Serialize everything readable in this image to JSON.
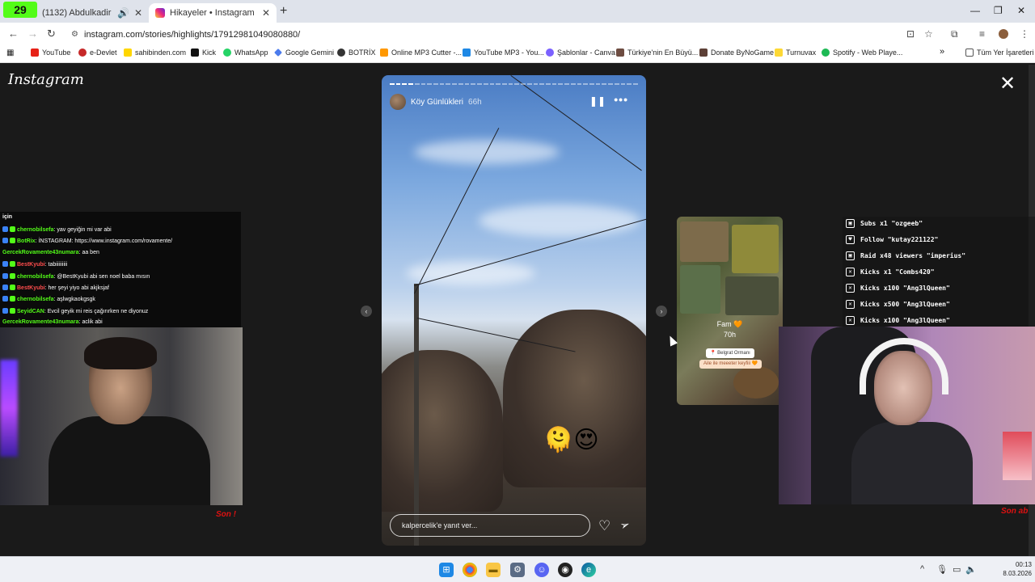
{
  "browser": {
    "kick_badge": "29",
    "tabs": [
      {
        "title": "(1132) Abdulkadir Geylani -",
        "close": "✕"
      },
      {
        "title": "Hikayeler • Instagram",
        "close": "✕"
      }
    ],
    "new_tab": "+",
    "url": "instagram.com/stories/highlights/17912981049080880/",
    "bookmarks": [
      {
        "label": "YouTube",
        "color": "#e62117"
      },
      {
        "label": "e-Devlet",
        "color": "#c62828"
      },
      {
        "label": "sahibinden.com",
        "color": "#ffd600"
      },
      {
        "label": "Kick",
        "color": "#111111"
      },
      {
        "label": "WhatsApp",
        "color": "#25d366"
      },
      {
        "label": "Google Gemini",
        "color": "#4b7bec"
      },
      {
        "label": "BOTRİX",
        "color": "#333333"
      },
      {
        "label": "Online MP3 Cutter -...",
        "color": "#ff9800"
      },
      {
        "label": "YouTube MP3 - You...",
        "color": "#1e88e5"
      },
      {
        "label": "Şablonlar - Canva",
        "color": "#7b61ff"
      },
      {
        "label": "Türkiye'nin En Büyü...",
        "color": "#6d4c41"
      },
      {
        "label": "Donate ByNoGame",
        "color": "#5d4037"
      },
      {
        "label": "Turnuvax",
        "color": "#fdd835"
      },
      {
        "label": "Spotify - Web Playe...",
        "color": "#1db954"
      }
    ],
    "bookmarks_more": "»",
    "all_bookmarks": "Tüm Yer İşaretleri"
  },
  "instagram": {
    "logo": "Instagram",
    "close": "✕",
    "story": {
      "username": "Köy Günlükleri",
      "time": "66h",
      "segments_total": 40,
      "segments_done": 4,
      "reply_placeholder": "kalpercelik'e yanıt ver...",
      "emojis": "🫠😍"
    },
    "next_story": {
      "title": "Fam 🧡",
      "time": "70h",
      "location": "📍 Belgrat Ormanı",
      "sub": "Aile ile meeeter keyfiii 🧡"
    }
  },
  "chat": {
    "header": "için",
    "messages": [
      {
        "user": "chernobilsefa",
        "text": ": yav geyiğin mi var abi",
        "color": "green",
        "badges": true
      },
      {
        "user": "BotRix",
        "text": ": İNSTAGRAM: https://www.instagram.com/rovamente/",
        "color": "green",
        "badges": true
      },
      {
        "user": "GercekRovamente43numara",
        "text": ": aa ben",
        "color": "green",
        "badges": false
      },
      {
        "user": "BestKyubi",
        "text": ": tabiiiiiiiii",
        "color": "red",
        "badges": true
      },
      {
        "user": "chernobilsefa",
        "text": ": @BestKyubi abi sen noel baba mısın",
        "color": "green",
        "badges": true
      },
      {
        "user": "BestKyubi",
        "text": ": her şeyi yiyo abi akjksjaf",
        "color": "red",
        "badges": true
      },
      {
        "user": "chernobilsefa",
        "text": ": aşlwgkaokgsgk",
        "color": "green",
        "badges": true
      },
      {
        "user": "SeyidCAN",
        "text": ": Evcil geyik mi reis çağırırken ne diyonuz",
        "color": "green",
        "badges": true
      },
      {
        "user": "GercekRovamente43numara",
        "text": ": aclik abi",
        "color": "green",
        "badges": false
      }
    ]
  },
  "overlay_labels": {
    "left": "Son !",
    "right": "Son ab"
  },
  "alerts": [
    {
      "icon": "box",
      "text": "Subs x1 \"ozgeeb\""
    },
    {
      "icon": "heart",
      "text": "Follow \"kutay221122\""
    },
    {
      "icon": "box",
      "text": "Raid x48 viewers \"imperius\""
    },
    {
      "icon": "x",
      "text": "Kicks x1 \"Combs420\""
    },
    {
      "icon": "x",
      "text": "Kicks x100 \"Ang3lQueen\""
    },
    {
      "icon": "x",
      "text": "Kicks x500 \"Ang3lQueen\""
    },
    {
      "icon": "x",
      "text": "Kicks x100 \"Ang3lQueen\""
    }
  ],
  "taskbar": {
    "time": "00:13",
    "date": "8.03.2026"
  }
}
